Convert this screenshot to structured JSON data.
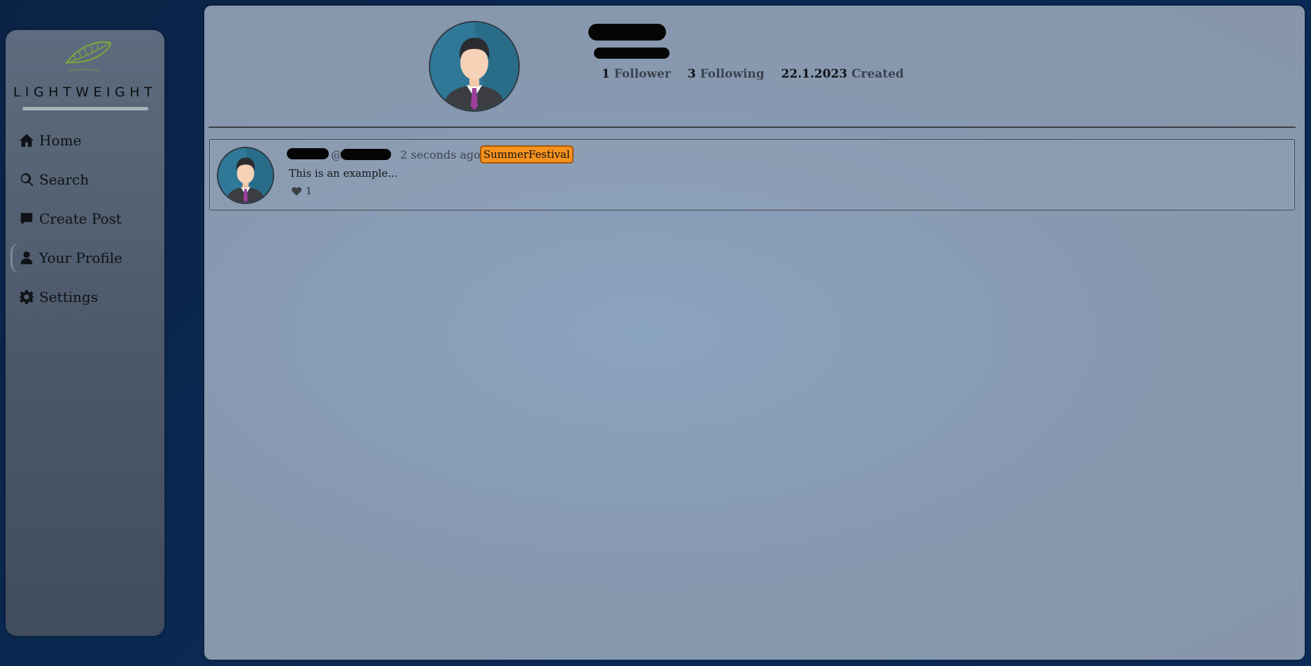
{
  "app": {
    "brand_name": "LIGHTWEIGHT",
    "accent_green": "#7fa63a"
  },
  "sidebar": {
    "items": [
      {
        "label": "Home",
        "icon": "home-icon"
      },
      {
        "label": "Search",
        "icon": "search-icon"
      },
      {
        "label": "Create Post",
        "icon": "comment-icon"
      },
      {
        "label": "Your Profile",
        "icon": "user-icon",
        "active": true
      },
      {
        "label": "Settings",
        "icon": "gear-icon"
      }
    ]
  },
  "profile": {
    "followers_count": "1",
    "followers_label": "Follower",
    "following_count": "3",
    "following_label": "Following",
    "created_date": "22.1.2023",
    "created_label": "Created"
  },
  "posts": [
    {
      "at_prefix": "@",
      "time_ago": "2 seconds ago",
      "tag": "SummerFestival",
      "tag_color": "#f5921e",
      "body": "This is an example...",
      "likes": "1"
    }
  ]
}
